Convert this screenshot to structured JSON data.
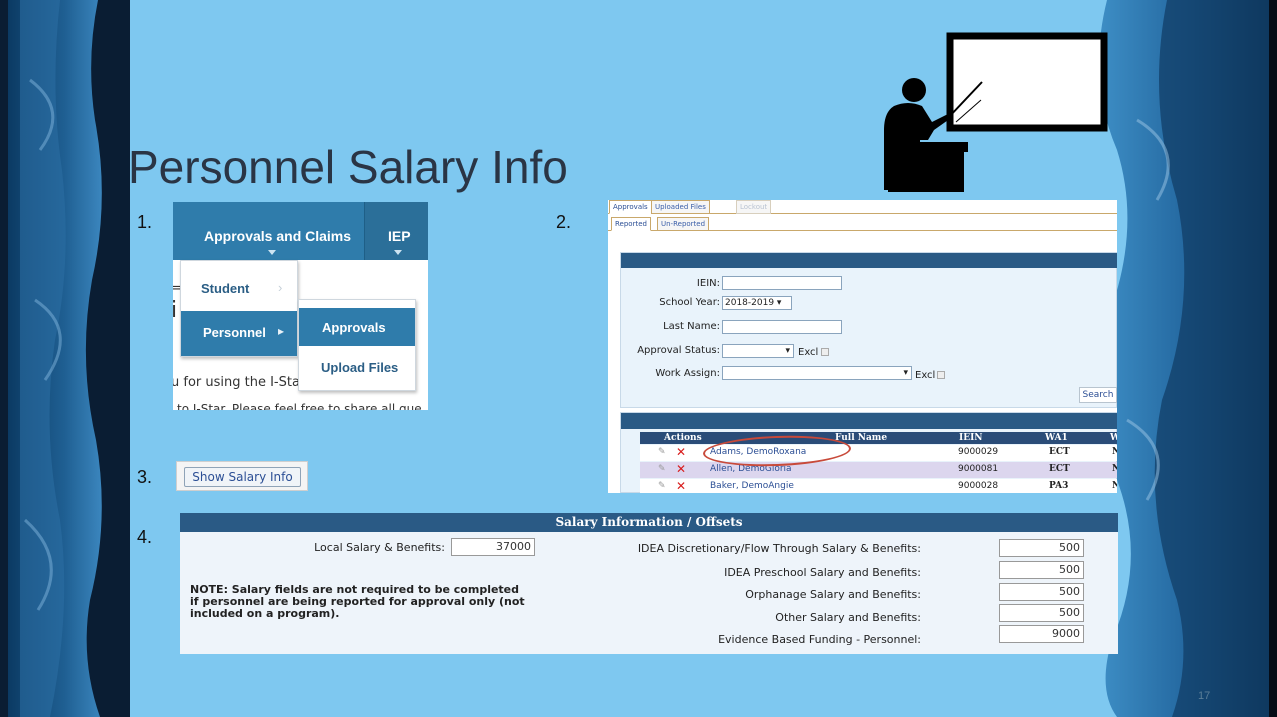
{
  "slide": {
    "title": "Personnel Salary Info",
    "steps": [
      "1.",
      "2.",
      "3.",
      "4."
    ],
    "number": "17"
  },
  "panel1": {
    "nav_approvals": "Approvals and Claims",
    "nav_iep": "IEP",
    "menu_student": "Student",
    "menu_personnel": "Personnel",
    "submenu_approvals": "Approvals",
    "submenu_upload": "Upload Files",
    "bg_line1": "u for using the I-Sta",
    "bg_line2": "to I-Star. Please feel free to share all que",
    "bg_frag1": "=",
    "bg_frag2": "i"
  },
  "panel2": {
    "tabs": [
      "Approvals",
      "Uploaded Files",
      "Lockout"
    ],
    "subtabs": [
      "Reported",
      "Un-Reported"
    ],
    "form": {
      "iein_label": "IEIN:",
      "iein_value": "",
      "school_year_label": "School Year:",
      "school_year_value": "2018-2019",
      "last_name_label": "Last Name:",
      "last_name_value": "",
      "approval_status_label": "Approval Status:",
      "approval_status_value": "",
      "work_assign_label": "Work Assign:",
      "work_assign_value": "",
      "excl_label": "Excl",
      "search_button": "Search"
    },
    "grid": {
      "columns": [
        "Actions",
        "Full Name",
        "IEIN",
        "WA1",
        "W"
      ],
      "rows": [
        {
          "name": "Adams, DemoRoxana",
          "iein": "9000029",
          "wa1": "ECT",
          "w": "N"
        },
        {
          "name": "Allen, DemoGloria",
          "iein": "9000081",
          "wa1": "ECT",
          "w": "N"
        },
        {
          "name": "Baker, DemoAngie",
          "iein": "9000028",
          "wa1": "PA3",
          "w": "N"
        }
      ]
    }
  },
  "panel3": {
    "button": "Show Salary Info"
  },
  "panel4": {
    "header": "Salary Information / Offsets",
    "local_label": "Local Salary & Benefits:",
    "local_value": "37000",
    "note": "NOTE: Salary fields are not required to be completed if personnel are being reported for approval only (not included on a program).",
    "fields": [
      {
        "label": "IDEA Discretionary/Flow Through Salary & Benefits:",
        "value": "500"
      },
      {
        "label": "IDEA Preschool Salary and Benefits:",
        "value": "500"
      },
      {
        "label": "Orphanage Salary and Benefits:",
        "value": "500"
      },
      {
        "label": "Other Salary and Benefits:",
        "value": "500"
      },
      {
        "label": "Evidence Based Funding - Personnel:",
        "value": "9000"
      }
    ]
  }
}
